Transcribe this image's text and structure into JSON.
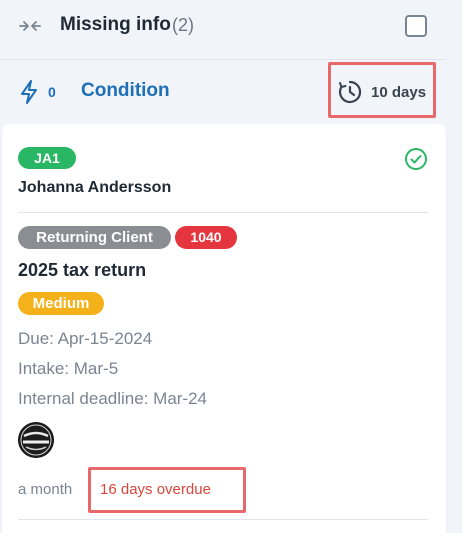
{
  "header": {
    "title": "Missing info",
    "count": "(2)"
  },
  "meta": {
    "bolt_count": "0",
    "condition_label": "Condition",
    "duration": "10 days"
  },
  "card": {
    "client_badge": "JA1",
    "client_name": "Johanna Andersson",
    "tags": {
      "client_type": "Returning Client",
      "form": "1040"
    },
    "task_title": "2025 tax return",
    "priority": "Medium",
    "due": "Due: Apr-15-2024",
    "intake": "Intake: Mar-5",
    "internal_deadline": "Internal deadline: Mar-24",
    "avatar_alt": "GENERAL LEDGER",
    "age": "a month",
    "overdue": "16 days overdue"
  },
  "icons": {
    "collapse": "collapse-arrows-icon",
    "bolt": "bolt-icon",
    "clock": "clock-history-icon",
    "check": "check-circle-icon"
  },
  "colors": {
    "accent_blue": "#1d6fb8",
    "green": "#29b765",
    "gray_tag": "#8a8d92",
    "red_tag": "#e5353f",
    "priority_medium": "#f5b119",
    "highlight_box": "#e8696b",
    "overdue_text": "#d9473b"
  }
}
